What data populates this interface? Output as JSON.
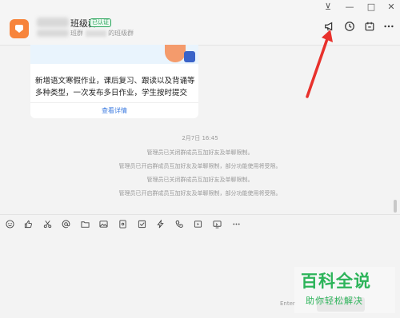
{
  "window_controls": {
    "pin": "⊻",
    "minimize": "—",
    "maximize": "□",
    "close": "✕"
  },
  "header": {
    "title": "班级群",
    "badge": "已认证",
    "subtitle_a": "班群",
    "subtitle_b": "的班级群"
  },
  "card": {
    "text": "新增语文寒假作业，课后复习、跟读以及背诵等多种类型，一次发布多日作业，学生按时提交",
    "link": "查看详情"
  },
  "timestamp": "2月7日 16:45",
  "system_messages": [
    "管理员已关闭群成员互加好友及单聊限制。",
    "管理员已开启群成员互加好友及单聊限制，部分功能使用将受限。",
    "管理员已关闭群成员互加好友及单聊限制。",
    "管理员已开启群成员互加好友及单聊限制，部分功能使用将受限。"
  ],
  "toolbar_icons": [
    "emoji-icon",
    "thumbs-up-icon",
    "scissors-icon",
    "mention-icon",
    "folder-icon",
    "image-icon",
    "red-packet-icon",
    "checkbox-icon",
    "lightning-icon",
    "phone-icon",
    "video-icon",
    "screen-share-icon",
    "more-icon"
  ],
  "input": {
    "hint": "Enter"
  },
  "watermark": {
    "line1": "百科全说",
    "line2": "助你轻松解决"
  },
  "colors": {
    "accent": "#3c7be0",
    "avatar": "#f7843b",
    "arrow": "#e8312c",
    "watermark": "#2db45a"
  }
}
